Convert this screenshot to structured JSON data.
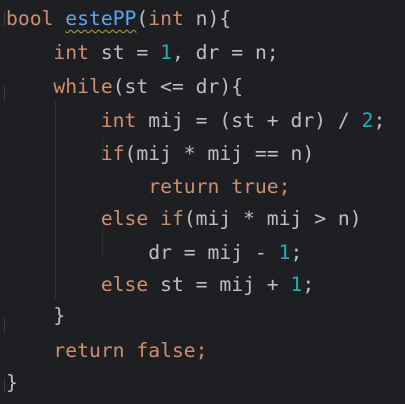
{
  "editor": {
    "colors": {
      "background": "#1e1f22",
      "text": "#bcbec4",
      "keyword": "#cf8e6d",
      "number": "#2aacb8",
      "function": "#56a8f5",
      "warning_underline": "#b6a14a"
    },
    "lines": [
      {
        "tokens": [
          {
            "t": "bool",
            "k": "kw"
          },
          {
            "t": " "
          },
          {
            "t": "estePP",
            "k": "fn warn"
          },
          {
            "t": "("
          },
          {
            "t": "int",
            "k": "kw"
          },
          {
            "t": " n){"
          }
        ]
      },
      {
        "tokens": [
          {
            "t": "    "
          },
          {
            "t": "int",
            "k": "kw"
          },
          {
            "t": " st = "
          },
          {
            "t": "1",
            "k": "num"
          },
          {
            "t": ", dr = n;"
          }
        ]
      },
      {
        "tokens": [
          {
            "t": "    "
          },
          {
            "t": "while",
            "k": "kw"
          },
          {
            "t": "(st <= dr){"
          }
        ]
      },
      {
        "tokens": [
          {
            "t": "        "
          },
          {
            "t": "int",
            "k": "kw"
          },
          {
            "t": " mij = (st + dr) / "
          },
          {
            "t": "2",
            "k": "num"
          },
          {
            "t": ";"
          }
        ]
      },
      {
        "tokens": [
          {
            "t": "        "
          },
          {
            "t": "if",
            "k": "kw"
          },
          {
            "t": "(mij * mij == n)"
          }
        ]
      },
      {
        "tokens": [
          {
            "t": "            "
          },
          {
            "t": "return true",
            "k": "kw"
          },
          {
            "t": ";",
            "k": "kw"
          }
        ]
      },
      {
        "tokens": [
          {
            "t": "        "
          },
          {
            "t": "else if",
            "k": "kw"
          },
          {
            "t": "(mij * mij > n)"
          }
        ]
      },
      {
        "tokens": [
          {
            "t": "            dr = mij - "
          },
          {
            "t": "1",
            "k": "num"
          },
          {
            "t": ";"
          }
        ]
      },
      {
        "tokens": [
          {
            "t": "        "
          },
          {
            "t": "else",
            "k": "kw"
          },
          {
            "t": " st = mij + "
          },
          {
            "t": "1",
            "k": "num"
          },
          {
            "t": ";"
          }
        ]
      },
      {
        "tokens": [
          {
            "t": "    }"
          }
        ]
      },
      {
        "tokens": [
          {
            "t": "    "
          },
          {
            "t": "return false",
            "k": "kw"
          },
          {
            "t": ";",
            "k": "kw"
          }
        ]
      },
      {
        "tokens": [
          {
            "t": "}"
          }
        ]
      }
    ]
  }
}
